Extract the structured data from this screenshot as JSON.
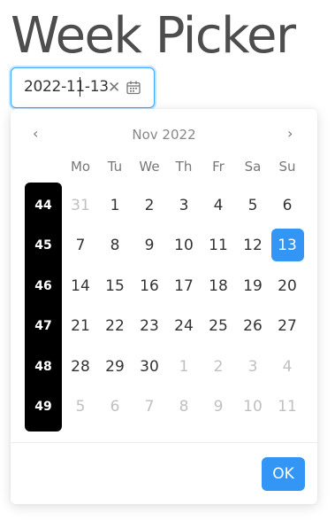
{
  "page": {
    "title": "Week Picker"
  },
  "picker": {
    "value": "2022-11-13",
    "clear_icon": "close-icon",
    "calendar_icon": "calendar-icon"
  },
  "calendar": {
    "prev": "‹",
    "next": "›",
    "month_label": "Nov 2022",
    "weekdays": [
      "Mo",
      "Tu",
      "We",
      "Th",
      "Fr",
      "Sa",
      "Su"
    ],
    "accent_color": "#3396f5",
    "selected_date": "13",
    "weeks": [
      {
        "week": "44",
        "days": [
          {
            "d": "31",
            "muted": true
          },
          {
            "d": "1"
          },
          {
            "d": "2"
          },
          {
            "d": "3"
          },
          {
            "d": "4"
          },
          {
            "d": "5"
          },
          {
            "d": "6"
          }
        ]
      },
      {
        "week": "45",
        "days": [
          {
            "d": "7"
          },
          {
            "d": "8"
          },
          {
            "d": "9"
          },
          {
            "d": "10"
          },
          {
            "d": "11"
          },
          {
            "d": "12"
          },
          {
            "d": "13",
            "selected": true
          }
        ]
      },
      {
        "week": "46",
        "days": [
          {
            "d": "14"
          },
          {
            "d": "15"
          },
          {
            "d": "16"
          },
          {
            "d": "17"
          },
          {
            "d": "18"
          },
          {
            "d": "19"
          },
          {
            "d": "20"
          }
        ]
      },
      {
        "week": "47",
        "days": [
          {
            "d": "21"
          },
          {
            "d": "22"
          },
          {
            "d": "23"
          },
          {
            "d": "24"
          },
          {
            "d": "25"
          },
          {
            "d": "26"
          },
          {
            "d": "27"
          }
        ]
      },
      {
        "week": "48",
        "days": [
          {
            "d": "28"
          },
          {
            "d": "29"
          },
          {
            "d": "30"
          },
          {
            "d": "1",
            "muted": true
          },
          {
            "d": "2",
            "muted": true
          },
          {
            "d": "3",
            "muted": true
          },
          {
            "d": "4",
            "muted": true
          }
        ]
      },
      {
        "week": "49",
        "days": [
          {
            "d": "5",
            "muted": true
          },
          {
            "d": "6",
            "muted": true
          },
          {
            "d": "7",
            "muted": true
          },
          {
            "d": "8",
            "muted": true
          },
          {
            "d": "9",
            "muted": true
          },
          {
            "d": "10",
            "muted": true
          },
          {
            "d": "11",
            "muted": true
          }
        ]
      }
    ]
  },
  "footer": {
    "ok_label": "OK"
  }
}
